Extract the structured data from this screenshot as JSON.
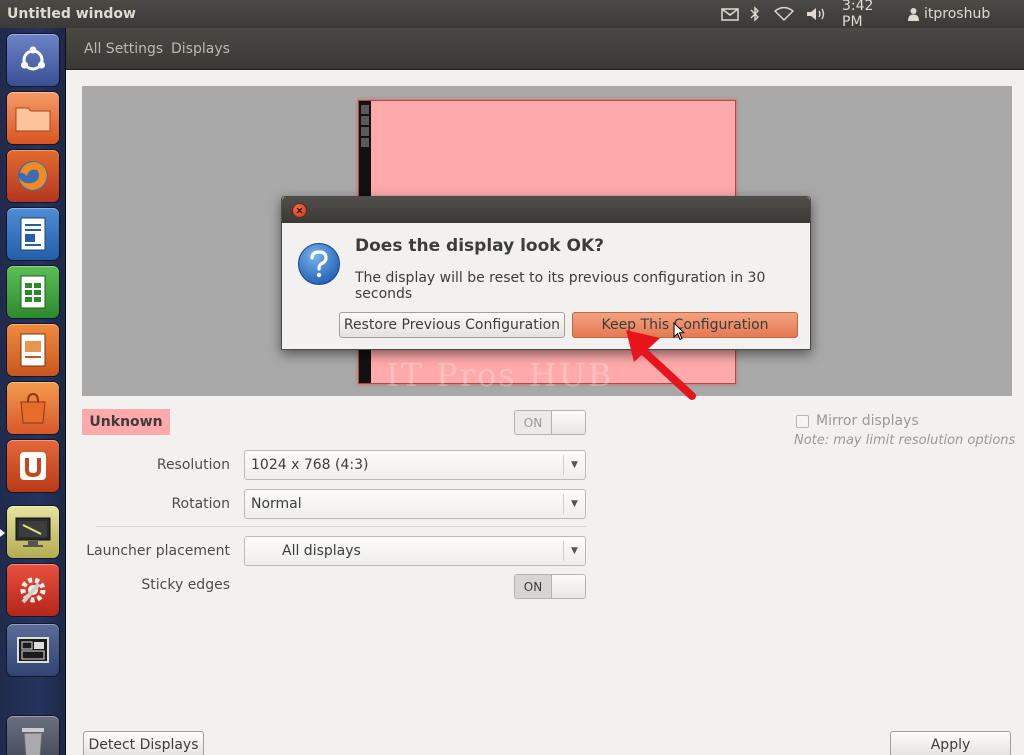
{
  "topbar": {
    "window_title": "Untitled window",
    "time": "3:42 PM",
    "user": "itproshub",
    "icons": [
      "mail-icon",
      "bluetooth-icon",
      "wifi-icon",
      "volume-icon",
      "user-icon"
    ]
  },
  "launcher": {
    "items": [
      "dash-home",
      "files",
      "firefox",
      "libreoffice-writer",
      "libreoffice-calc",
      "libreoffice-impress",
      "ubuntu-software-center",
      "ubuntu-one",
      "displays",
      "system-settings",
      "workspace-switcher",
      "trash"
    ]
  },
  "header": {
    "all_settings": "All Settings",
    "displays": "Displays"
  },
  "preview": {
    "monitor_color": "#ffaaaa",
    "watermark": "IT Pros HUB"
  },
  "dialog": {
    "heading": "Does the display look OK?",
    "message": "The display will be reset to its previous configuration in 30 seconds",
    "restore_label": "Restore Previous Configuration",
    "keep_label": "Keep This Configuration"
  },
  "settings": {
    "monitor_name": "Unknown",
    "monitor_switch": "ON",
    "mirror_label": "Mirror displays",
    "mirror_checked": false,
    "mirror_note": "Note: may limit resolution options",
    "resolution_label": "Resolution",
    "resolution_value": "1024 x 768 (4:3)",
    "rotation_label": "Rotation",
    "rotation_value": "Normal",
    "launcher_placement_label": "Launcher placement",
    "launcher_placement_value": "All displays",
    "sticky_edges_label": "Sticky edges",
    "sticky_edges_value": "ON"
  },
  "footer": {
    "detect_label": "Detect Displays",
    "apply_label": "Apply"
  },
  "colors": {
    "accent": "#e47a52",
    "arrow": "#e8141b"
  }
}
